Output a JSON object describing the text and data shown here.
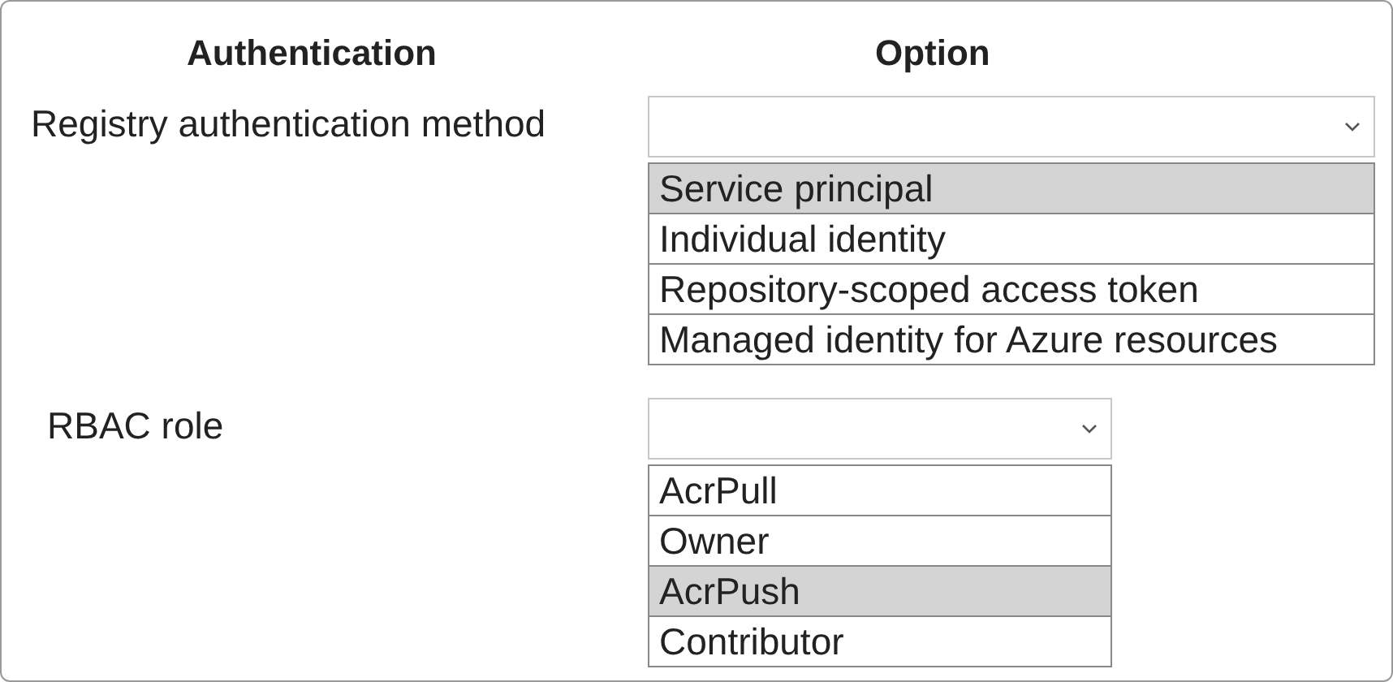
{
  "columns": [
    "Authentication",
    "Option"
  ],
  "rows": [
    {
      "label": "Registry authentication method",
      "options": [
        {
          "label": "Service principal",
          "selected": true
        },
        {
          "label": "Individual identity",
          "selected": false
        },
        {
          "label": "Repository-scoped access token",
          "selected": false
        },
        {
          "label": "Managed identity for Azure resources",
          "selected": false
        }
      ]
    },
    {
      "label": "RBAC role",
      "options": [
        {
          "label": "AcrPull",
          "selected": false
        },
        {
          "label": "Owner",
          "selected": false
        },
        {
          "label": "AcrPush",
          "selected": true
        },
        {
          "label": "Contributor",
          "selected": false
        }
      ]
    }
  ]
}
